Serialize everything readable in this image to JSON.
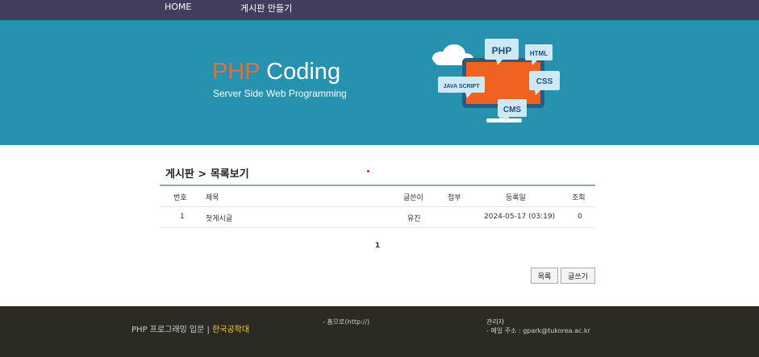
{
  "nav": {
    "home": "HOME",
    "make_board": "게시판 만들기"
  },
  "banner": {
    "title_php": "PHP",
    "title_rest": " Coding",
    "subtitle": "Server Side Web Programming",
    "icons": [
      "cloud-icon",
      "monitor-icon"
    ],
    "bubbles": {
      "php": "PHP",
      "html": "HTML",
      "css": "CSS",
      "js": "JAVA SCRIPT",
      "cms": "CMS"
    },
    "colors": {
      "background": "#2593af",
      "php_accent": "#ef6a33"
    }
  },
  "board": {
    "title": "게시판 > 목록보기",
    "headers": {
      "no": "번호",
      "subject": "제목",
      "writer": "글쓴이",
      "attach": "첨부",
      "date": "등록일",
      "views": "조회"
    },
    "rows": [
      {
        "no": "1",
        "subject": "첫게시글",
        "writer": "유진",
        "attach": "",
        "date": "2024-05-17 (03:19)",
        "views": "0"
      }
    ],
    "page": "1",
    "buttons": {
      "list": "목록",
      "write": "글쓰기"
    }
  },
  "footer": {
    "left_text": "PHP 프로그래밍 입문 | ",
    "school": "한국공학대",
    "home_link": "- 홈으로(http://)",
    "admin_label": "관리자",
    "email": "- 메일 주소 : gpark@tukorea.ac.kr"
  }
}
